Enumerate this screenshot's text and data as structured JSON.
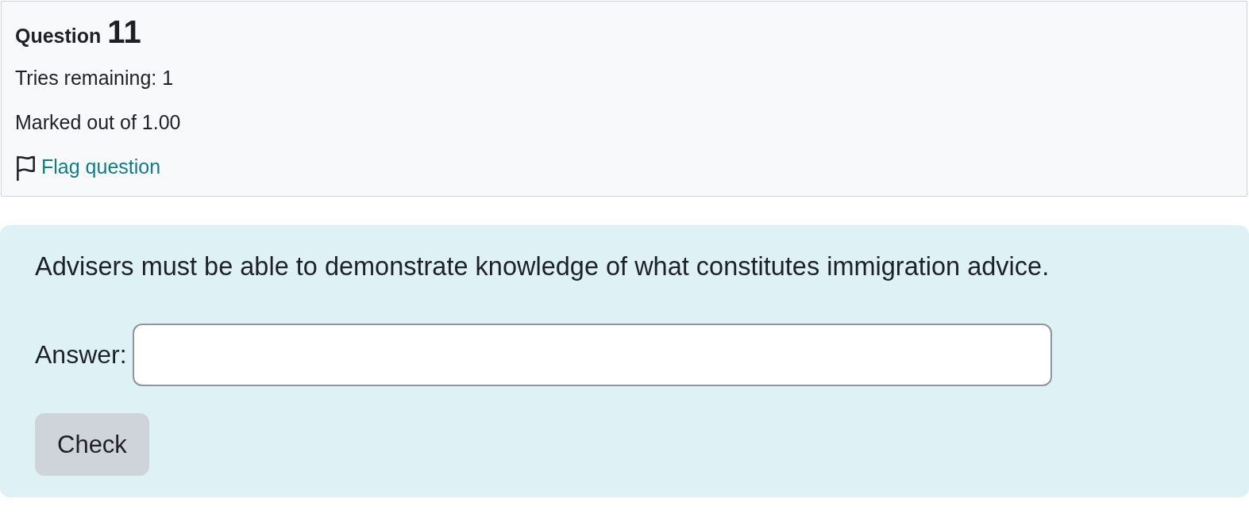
{
  "info": {
    "heading": {
      "label": "Question",
      "number": "11"
    },
    "state": "Tries remaining: 1",
    "grade": "Marked out of 1.00",
    "flag_link": {
      "label": "Flag question",
      "flagged": false
    }
  },
  "content": {
    "question_text": "Advisers must be able to demonstrate knowledge of what constitutes immigration advice.",
    "answer": {
      "label": "Answer:"
    },
    "buttons": [
      {
        "label": "Check",
        "kind": "secondary"
      }
    ]
  }
}
